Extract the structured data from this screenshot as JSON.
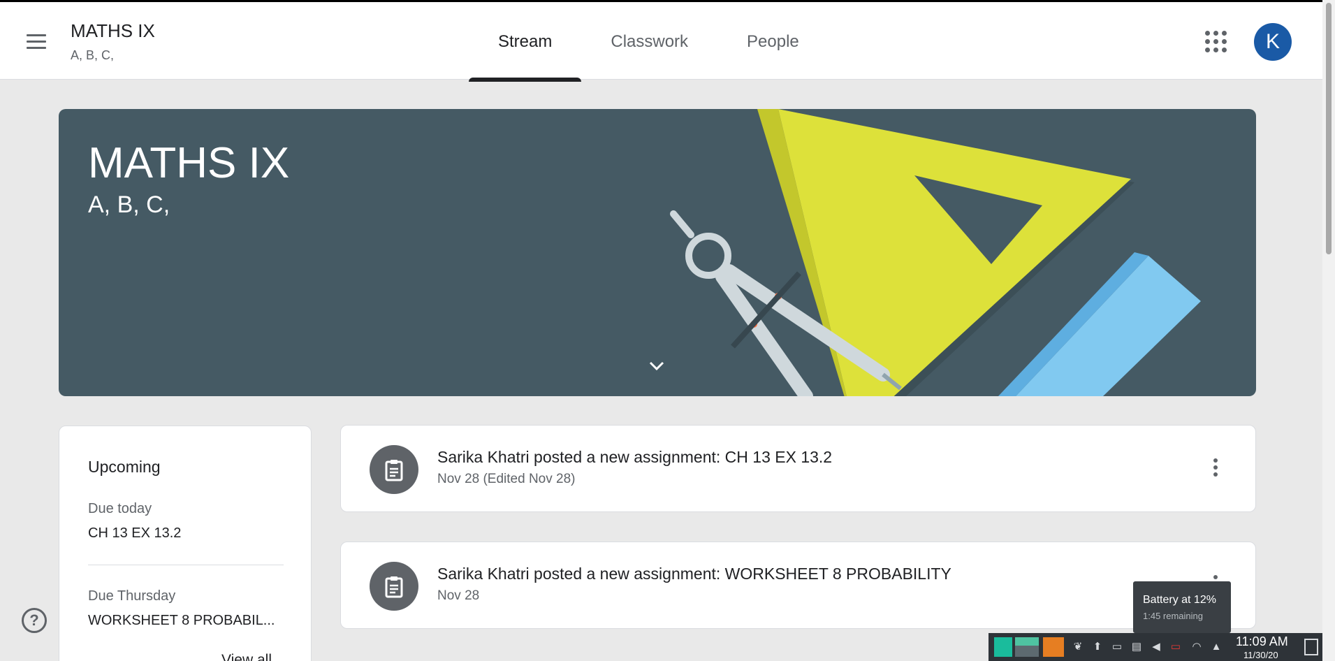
{
  "header": {
    "class_name": "MATHS IX",
    "sections": "A, B, C,",
    "tabs": [
      {
        "label": "Stream",
        "active": true
      },
      {
        "label": "Classwork",
        "active": false
      },
      {
        "label": "People",
        "active": false
      }
    ],
    "avatar_initial": "K",
    "icons": [
      "menu-icon",
      "apps-grid-icon"
    ]
  },
  "banner": {
    "title": "MATHS IX",
    "subtitle": "A, B, C,",
    "background_color": "#455a64"
  },
  "upcoming": {
    "title": "Upcoming",
    "items": [
      {
        "label": "Due today",
        "value": "CH 13 EX 13.2"
      },
      {
        "label": "Due Thursday",
        "value": "WORKSHEET 8 PROBABIL..."
      }
    ],
    "view_all": "View all"
  },
  "stream": [
    {
      "text": "Sarika Khatri posted a new assignment: CH 13 EX 13.2",
      "date": "Nov 28 (Edited Nov 28)"
    },
    {
      "text": "Sarika Khatri posted a new assignment: WORKSHEET 8 PROBABILITY",
      "date": "Nov 28"
    }
  ],
  "tooltip": {
    "title": "Battery at 12%",
    "subtitle": "1:45 remaining"
  },
  "taskbar": {
    "time": "11:09 AM",
    "date": "11/30/20",
    "tray_icons": [
      "plant-icon",
      "upload-icon",
      "terminal-icon",
      "clipboard-icon",
      "volume-icon",
      "battery-icon",
      "wifi-icon",
      "up-arrow-icon"
    ]
  },
  "colors": {
    "accent": "#1a5aa6",
    "banner": "#455a64",
    "text_secondary": "#5f6368"
  }
}
